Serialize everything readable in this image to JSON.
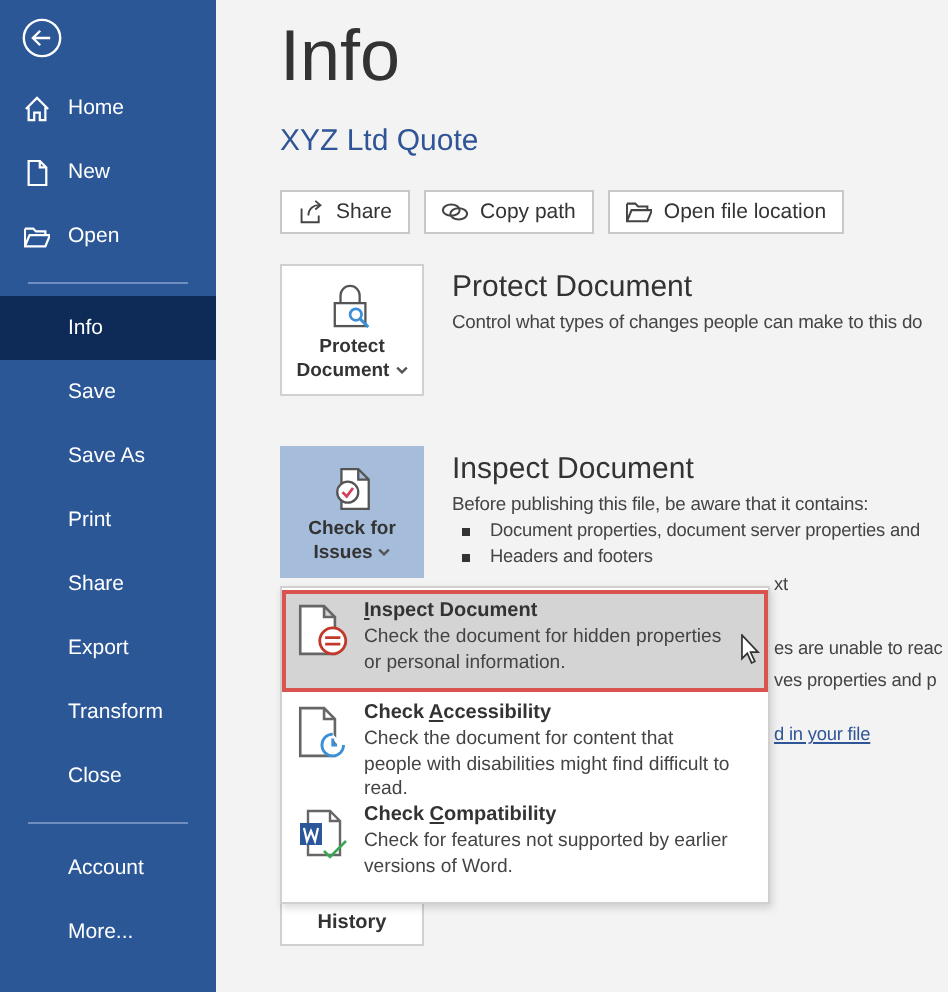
{
  "sidebar": {
    "items": [
      {
        "label": "Home",
        "selected": false
      },
      {
        "label": "New",
        "selected": false
      },
      {
        "label": "Open",
        "selected": false,
        "divider_after": true
      },
      {
        "label": "Info",
        "selected": true
      },
      {
        "label": "Save",
        "selected": false
      },
      {
        "label": "Save As",
        "selected": false
      },
      {
        "label": "Print",
        "selected": false
      },
      {
        "label": "Share",
        "selected": false
      },
      {
        "label": "Export",
        "selected": false
      },
      {
        "label": "Transform",
        "selected": false
      },
      {
        "label": "Close",
        "selected": false,
        "divider_after": true
      },
      {
        "label": "Account",
        "selected": false
      },
      {
        "label": "More...",
        "selected": false
      }
    ]
  },
  "page_title": "Info",
  "document_name": "XYZ Ltd Quote",
  "actions": [
    {
      "label": "Share"
    },
    {
      "label": "Copy path"
    },
    {
      "label": "Open file location"
    }
  ],
  "protect": {
    "button": [
      "Protect",
      "Document"
    ],
    "title": "Protect Document",
    "description": "Control what types of changes people can make to this do"
  },
  "inspect": {
    "button": [
      "Check for",
      "Issues"
    ],
    "pressed": true,
    "title": "Inspect Document",
    "description": "Before publishing this file, be aware that it contains:",
    "bullets": [
      "Document properties, document server properties and",
      "Headers and footers"
    ],
    "fragments": [
      {
        "text": "xt",
        "kind": "plain"
      },
      {
        "text": "es are unable to reac",
        "kind": "plain"
      },
      {
        "text": "ves properties and p",
        "kind": "plain"
      },
      {
        "text": "d in your file",
        "kind": "link"
      }
    ]
  },
  "version_history": {
    "label": "History"
  },
  "menu": [
    {
      "key": "I",
      "key_after": "nspect Document",
      "description": "Check the document for hidden properties or personal information.",
      "selected": true
    },
    {
      "key_before": "Check ",
      "key": "A",
      "key_after": "ccessibility",
      "description": "Check the document for content that people with disabilities might find difficult to read.",
      "selected": false
    },
    {
      "key_before": "Check ",
      "key": "C",
      "key_after": "ompatibility",
      "description": "Check for features not supported by earlier versions of Word.",
      "selected": false
    }
  ]
}
